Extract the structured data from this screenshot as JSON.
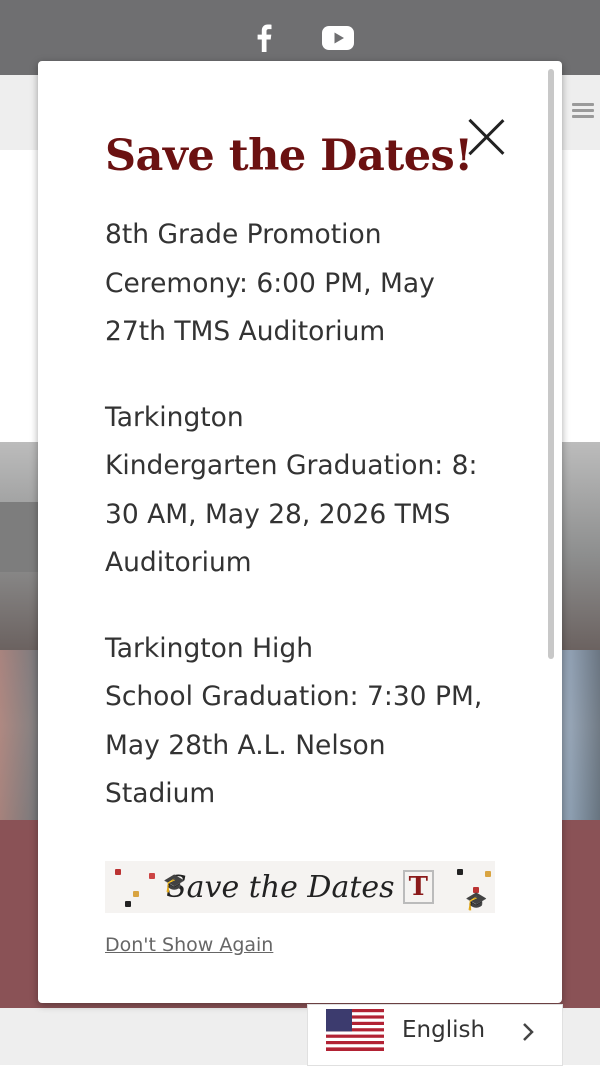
{
  "social": {
    "facebook_icon": "facebook-icon",
    "youtube_icon": "youtube-icon"
  },
  "modal": {
    "title": "Save the Dates!",
    "close_icon": "close-icon",
    "events": [
      "8th Grade Promotion\nCeremony: 6:00 PM, May\n27th  TMS Auditorium",
      "Tarkington\nKindergarten Graduation: 8:\n30 AM, May 28, 2026   TMS\nAuditorium",
      "Tarkington High\nSchool Graduation: 7:30 PM,\nMay 28th  A.L. Nelson\nStadium"
    ],
    "banner_text": "Save the Dates",
    "banner_logo": "T",
    "dont_show_again": "Don't Show Again"
  },
  "language": {
    "label": "English",
    "flag_icon": "us-flag-icon",
    "chevron_icon": "chevron-right-icon"
  },
  "colors": {
    "title": "#6b1111",
    "topbar": "#6f6f71",
    "maroon_band": "#8a5256"
  }
}
